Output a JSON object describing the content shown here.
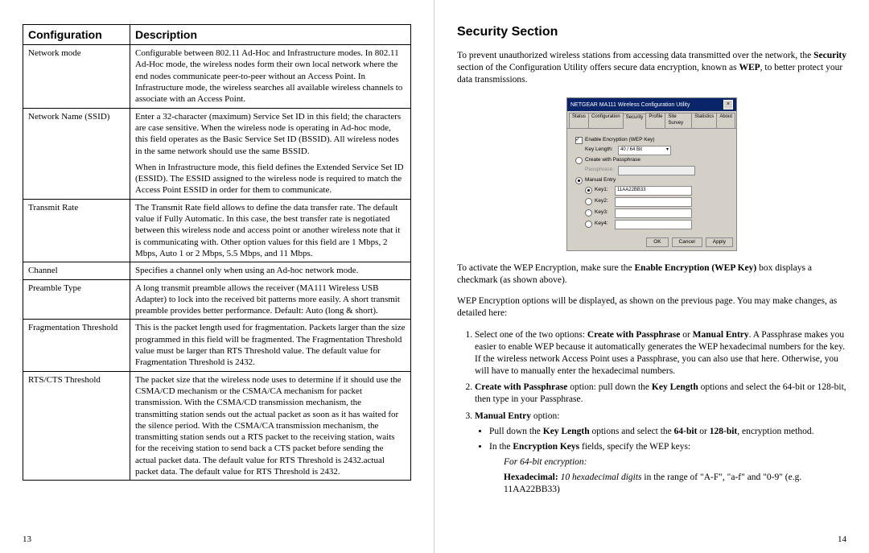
{
  "left": {
    "headers": {
      "col1": "Configuration",
      "col2": "Description"
    },
    "rows": [
      {
        "name": "Network mode",
        "desc": "Configurable between 802.11 Ad-Hoc and Infrastructure modes. In 802.11 Ad-Hoc mode, the wireless nodes form their own local network where the end nodes communicate peer-to-peer without an Access Point. In Infrastructure mode, the wireless searches all available wireless channels to associate with an Access Point."
      },
      {
        "name": "Network Name (SSID)",
        "desc_p1": "Enter a 32-character (maximum) Service Set ID in this field; the characters are case sensitive. When the wireless node is operating in Ad-hoc mode, this field operates as the Basic Service Set ID (BSSID). All wireless nodes in the same network should use the same BSSID.",
        "desc_p2": "When in Infrastructure mode, this field defines the Extended Service Set ID (ESSID). The ESSID assigned to the wireless node is required to match the Access Point ESSID in order for them to communicate."
      },
      {
        "name": "Transmit Rate",
        "desc": "The Transmit Rate field allows to define the data transfer rate. The default value if Fully Automatic. In this case, the best transfer rate is negotiated between this wireless node and access point or another wireless note that it is communicating with. Other option values for this field are 1 Mbps, 2 Mbps, Auto 1 or 2 Mbps, 5.5 Mbps, and 11 Mbps."
      },
      {
        "name": "Channel",
        "desc": "Specifies a channel only when using an Ad-hoc network mode."
      },
      {
        "name": "Preamble Type",
        "desc": "A long transmit preamble allows the receiver (MA111 Wireless USB Adapter) to lock into the received bit patterns more easily. A short transmit preamble provides better performance. Default: Auto (long & short)."
      },
      {
        "name": "Fragmentation Threshold",
        "desc": "This is the packet length used for fragmentation. Packets larger than the size programmed in this field will be fragmented. The Fragmentation Threshold value must be larger than RTS Threshold value. The default value for Fragmentation Threshold is 2432."
      },
      {
        "name": "RTS/CTS Threshold",
        "desc": "The packet size that the wireless node uses to determine if it should use the CSMA/CD mechanism or the CSMA/CA mechanism for packet transmission.  With the CSMA/CD transmission mechanism, the transmitting station sends out the actual packet as soon as it has waited for the silence period.  With the CSMA/CA transmission mechanism, the transmitting station sends out a RTS packet to the receiving station, waits for the receiving station to send back a CTS packet before sending the actual packet data.  The default value for RTS Threshold is 2432.actual packet data.  The default value for RTS Threshold is 2432."
      }
    ],
    "page_number": "13"
  },
  "right": {
    "heading": "Security Section",
    "intro_pre": "To prevent unauthorized wireless stations from accessing data transmitted over the network, the ",
    "intro_b1": "Security",
    "intro_mid": " section of the Configuration Utility offers secure data encryption, known as ",
    "intro_b2": "WEP",
    "intro_post": ", to better protect your data transmissions.",
    "dialog": {
      "title": "NETGEAR MA111 Wireless Configuration Utility",
      "tabs": [
        "Status",
        "Configuration",
        "Security",
        "Profile",
        "Site Survey",
        "Statistics",
        "About"
      ],
      "enable_label": "Enable Encryption (WEP Key)",
      "keylen_label": "Key Length:",
      "keylen_value": "40 / 64 Bit",
      "create_pass": "Create with Passphrase",
      "passphrase_lbl": "Passphrase:",
      "manual_entry": "Manual Entry",
      "keys": [
        "Key1:",
        "Key2:",
        "Key3:",
        "Key4:"
      ],
      "key1_val": "11AA22BB33",
      "buttons": {
        "ok": "OK",
        "cancel": "Cancel",
        "apply": "Apply"
      }
    },
    "activate_pre": "To activate the WEP Encryption, make sure the ",
    "activate_b": "Enable Encryption (WEP Key)",
    "activate_post": " box displays a checkmark (as shown above).",
    "options_text": "WEP Encryption options will be displayed, as shown on the previous page. You may make changes, as detailed here:",
    "step1": {
      "pre": "Select one of the two options: ",
      "b1": "Create with Passphrase",
      "mid1": " or ",
      "b2": "Manual Entry",
      "post": ". A Passphrase makes you easier to enable WEP because it automatically generates the WEP hexadecimal numbers for the key. If the wireless network Access Point uses a Passphrase, you can also use that here.  Otherwise, you will have to manually enter the hexadecimal numbers."
    },
    "step2": {
      "b1": "Create with Passphrase",
      "t1": " option: pull down the ",
      "b2": "Key Length",
      "t2": " options and select the 64-bit or 128-bit, then type in your Passphrase."
    },
    "step3": {
      "b1": "Manual Entry",
      "t1": " option:",
      "bullet1_pre": "Pull down the ",
      "bullet1_b1": "Key Length",
      "bullet1_mid": " options and select the ",
      "bullet1_b2": "64-bit",
      "bullet1_mid2": " or ",
      "bullet1_b3": "128-bit",
      "bullet1_post": ", encryption method.",
      "bullet2_pre": "In the ",
      "bullet2_b": "Encryption Keys",
      "bullet2_post": " fields, specify the WEP keys:",
      "for64": "For 64-bit encryption:",
      "hex_b": "Hexadecimal:",
      "hex_i": " 10 hexadecimal digits",
      "hex_post": " in the range of \"A-F\", \"a-f\" and \"0-9\" (e.g. 11AA22BB33)"
    },
    "page_number": "14"
  }
}
